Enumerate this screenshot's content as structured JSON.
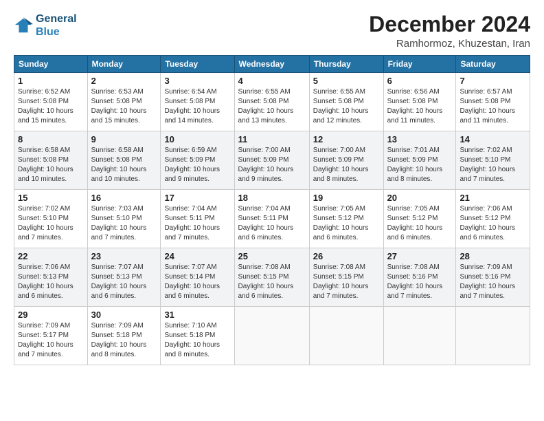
{
  "logo": {
    "line1": "General",
    "line2": "Blue"
  },
  "title": "December 2024",
  "location": "Ramhormoz, Khuzestan, Iran",
  "weekdays": [
    "Sunday",
    "Monday",
    "Tuesday",
    "Wednesday",
    "Thursday",
    "Friday",
    "Saturday"
  ],
  "weeks": [
    [
      {
        "day": "1",
        "detail": "Sunrise: 6:52 AM\nSunset: 5:08 PM\nDaylight: 10 hours\nand 15 minutes."
      },
      {
        "day": "2",
        "detail": "Sunrise: 6:53 AM\nSunset: 5:08 PM\nDaylight: 10 hours\nand 15 minutes."
      },
      {
        "day": "3",
        "detail": "Sunrise: 6:54 AM\nSunset: 5:08 PM\nDaylight: 10 hours\nand 14 minutes."
      },
      {
        "day": "4",
        "detail": "Sunrise: 6:55 AM\nSunset: 5:08 PM\nDaylight: 10 hours\nand 13 minutes."
      },
      {
        "day": "5",
        "detail": "Sunrise: 6:55 AM\nSunset: 5:08 PM\nDaylight: 10 hours\nand 12 minutes."
      },
      {
        "day": "6",
        "detail": "Sunrise: 6:56 AM\nSunset: 5:08 PM\nDaylight: 10 hours\nand 11 minutes."
      },
      {
        "day": "7",
        "detail": "Sunrise: 6:57 AM\nSunset: 5:08 PM\nDaylight: 10 hours\nand 11 minutes."
      }
    ],
    [
      {
        "day": "8",
        "detail": "Sunrise: 6:58 AM\nSunset: 5:08 PM\nDaylight: 10 hours\nand 10 minutes."
      },
      {
        "day": "9",
        "detail": "Sunrise: 6:58 AM\nSunset: 5:08 PM\nDaylight: 10 hours\nand 10 minutes."
      },
      {
        "day": "10",
        "detail": "Sunrise: 6:59 AM\nSunset: 5:09 PM\nDaylight: 10 hours\nand 9 minutes."
      },
      {
        "day": "11",
        "detail": "Sunrise: 7:00 AM\nSunset: 5:09 PM\nDaylight: 10 hours\nand 9 minutes."
      },
      {
        "day": "12",
        "detail": "Sunrise: 7:00 AM\nSunset: 5:09 PM\nDaylight: 10 hours\nand 8 minutes."
      },
      {
        "day": "13",
        "detail": "Sunrise: 7:01 AM\nSunset: 5:09 PM\nDaylight: 10 hours\nand 8 minutes."
      },
      {
        "day": "14",
        "detail": "Sunrise: 7:02 AM\nSunset: 5:10 PM\nDaylight: 10 hours\nand 7 minutes."
      }
    ],
    [
      {
        "day": "15",
        "detail": "Sunrise: 7:02 AM\nSunset: 5:10 PM\nDaylight: 10 hours\nand 7 minutes."
      },
      {
        "day": "16",
        "detail": "Sunrise: 7:03 AM\nSunset: 5:10 PM\nDaylight: 10 hours\nand 7 minutes."
      },
      {
        "day": "17",
        "detail": "Sunrise: 7:04 AM\nSunset: 5:11 PM\nDaylight: 10 hours\nand 7 minutes."
      },
      {
        "day": "18",
        "detail": "Sunrise: 7:04 AM\nSunset: 5:11 PM\nDaylight: 10 hours\nand 6 minutes."
      },
      {
        "day": "19",
        "detail": "Sunrise: 7:05 AM\nSunset: 5:12 PM\nDaylight: 10 hours\nand 6 minutes."
      },
      {
        "day": "20",
        "detail": "Sunrise: 7:05 AM\nSunset: 5:12 PM\nDaylight: 10 hours\nand 6 minutes."
      },
      {
        "day": "21",
        "detail": "Sunrise: 7:06 AM\nSunset: 5:12 PM\nDaylight: 10 hours\nand 6 minutes."
      }
    ],
    [
      {
        "day": "22",
        "detail": "Sunrise: 7:06 AM\nSunset: 5:13 PM\nDaylight: 10 hours\nand 6 minutes."
      },
      {
        "day": "23",
        "detail": "Sunrise: 7:07 AM\nSunset: 5:13 PM\nDaylight: 10 hours\nand 6 minutes."
      },
      {
        "day": "24",
        "detail": "Sunrise: 7:07 AM\nSunset: 5:14 PM\nDaylight: 10 hours\nand 6 minutes."
      },
      {
        "day": "25",
        "detail": "Sunrise: 7:08 AM\nSunset: 5:15 PM\nDaylight: 10 hours\nand 6 minutes."
      },
      {
        "day": "26",
        "detail": "Sunrise: 7:08 AM\nSunset: 5:15 PM\nDaylight: 10 hours\nand 7 minutes."
      },
      {
        "day": "27",
        "detail": "Sunrise: 7:08 AM\nSunset: 5:16 PM\nDaylight: 10 hours\nand 7 minutes."
      },
      {
        "day": "28",
        "detail": "Sunrise: 7:09 AM\nSunset: 5:16 PM\nDaylight: 10 hours\nand 7 minutes."
      }
    ],
    [
      {
        "day": "29",
        "detail": "Sunrise: 7:09 AM\nSunset: 5:17 PM\nDaylight: 10 hours\nand 7 minutes."
      },
      {
        "day": "30",
        "detail": "Sunrise: 7:09 AM\nSunset: 5:18 PM\nDaylight: 10 hours\nand 8 minutes."
      },
      {
        "day": "31",
        "detail": "Sunrise: 7:10 AM\nSunset: 5:18 PM\nDaylight: 10 hours\nand 8 minutes."
      },
      null,
      null,
      null,
      null
    ]
  ]
}
